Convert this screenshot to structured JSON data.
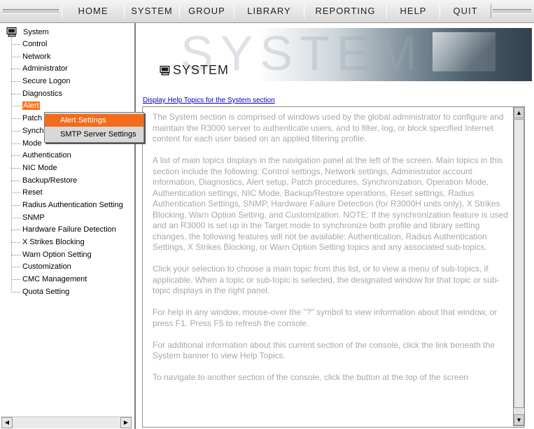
{
  "menubar": {
    "items": [
      "HOME",
      "SYSTEM",
      "GROUP",
      "LIBRARY",
      "REPORTING",
      "HELP",
      "QUIT"
    ]
  },
  "nav": {
    "root_label": "System",
    "items": [
      "Control",
      "Network",
      "Administrator",
      "Secure Logon",
      "Diagnostics",
      "Alert",
      "Patch",
      "Synch",
      "Mode",
      "Authentication",
      "NIC Mode",
      "Backup/Restore",
      "Reset",
      "Radius Authentication Setting",
      "SNMP",
      "Hardware Failure Detection",
      "X Strikes Blocking",
      "Warn Option Setting",
      "Customization",
      "CMC Management",
      "Quota Setting"
    ],
    "selected": "Alert"
  },
  "popup": {
    "items": [
      "Alert Settings",
      "SMTP Server Settings"
    ],
    "highlighted": "Alert Settings"
  },
  "banner": {
    "title": "SYSTEM",
    "ghost_text": "SYSTEM"
  },
  "help_link": "Display Help Topics for the System section",
  "content": {
    "paragraphs": [
      "The System section is comprised of windows used by the global administrator to configure and maintain the R3000 server to authenticate users, and to filter, log, or block specified Internet content for each user based on an applied filtering profile.",
      "A list of main topics displays in the navigation panel at the left of the screen. Main topics in this section include the following: Control settings, Network settings, Administrator account information, Diagnostics, Alert setup, Patch procedures, Synchronization, Operation Mode, Authentication settings, NIC Mode, Backup/Restore operations, Reset settings, Radius Authentication Settings, SNMP, Hardware Failure Detection (for R3000H units only), X Strikes Blocking, Warn Option Setting, and Customization. NOTE: If the synchronization feature is used and an R3000 is set up in the Target mode to synchronize both profile and library setting changes, the following features will not be available: Authentication, Radius Authentication Settings, X Strikes Blocking, or Warn Option Setting topics and any associated sub-topics.",
      "Click your selection to choose a main topic from this list, or to view a menu of sub-topics, if applicable. When a topic or sub-topic is selected, the designated window for that topic or sub-topic displays in the right panel.",
      "For help in any window, mouse-over the \"?\" symbol to view information about that window, or press F1. Press F5 to refresh the console.",
      "For additional information about this current section of the console, click the link beneath the System banner to view Help Topics.",
      "To navigate to another section of the console, click the button at the top of the screen"
    ]
  },
  "colors": {
    "selection_orange": "#f97316",
    "popup_highlight": "#f36c1c",
    "help_link": "#0000c0",
    "content_text": "#a8a8a8"
  }
}
